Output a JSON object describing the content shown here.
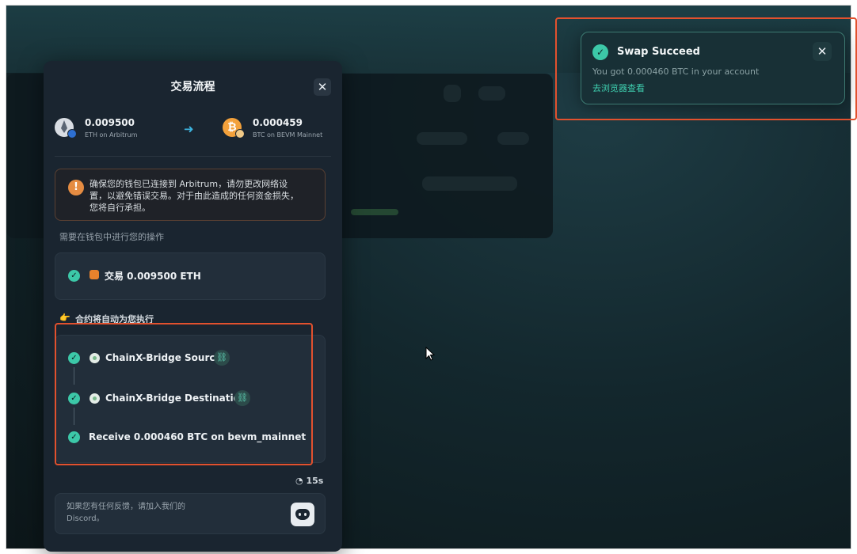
{
  "modal": {
    "title": "交易流程",
    "close_glyph": "✕",
    "from": {
      "amount": "0.009500",
      "network": "ETH on Arbitrum",
      "icon": "eth-icon"
    },
    "to": {
      "amount": "0.000459",
      "network": "BTC on BEVM Mainnet",
      "icon": "btc-icon"
    },
    "arrow_glyph": "➜",
    "warning": {
      "icon_glyph": "!",
      "text": "确保您的钱包已连接到 Arbitrum，请勿更改网络设置，以避免错误交易。对于由此造成的任何资金损失，您将自行承担。"
    },
    "wallet_section_label": "需要在钱包中进行您的操作",
    "wallet_step": {
      "text": "交易 0.009500 ETH"
    },
    "contract_section_label": "合约将自动为您执行",
    "contract_steps": [
      {
        "text": "ChainX-Bridge Source",
        "has_link": true
      },
      {
        "text": "ChainX-Bridge Destination",
        "has_link": true
      },
      {
        "text": "Receive 0.000460 BTC on bevm_mainnet",
        "has_link": false
      }
    ],
    "timer": "15s",
    "feedback": {
      "text": "如果您有任何反馈，请加入我们的 Discord。"
    }
  },
  "toast": {
    "title": "Swap Succeed",
    "message": "You got 0.000460 BTC in your account",
    "link_label": "去浏览器查看",
    "close_glyph": "✕"
  },
  "colors": {
    "success": "#3cc8a8",
    "warning": "#e58c42",
    "highlight": "#e2512e",
    "modal_bg": "#1a2530"
  }
}
